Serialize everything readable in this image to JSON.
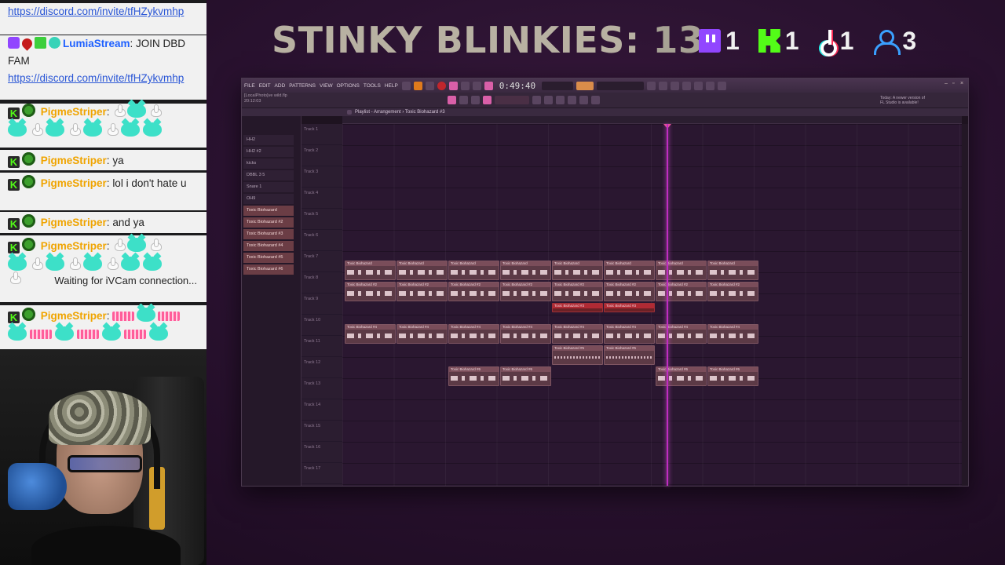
{
  "chat": {
    "messages": [
      {
        "type": "link",
        "text": "https://discord.com/invite/tfHZykvmhp"
      },
      {
        "type": "msg",
        "platform": "twitch",
        "name": "LumiaStream",
        "text": "JOIN DBD FAM"
      },
      {
        "type": "link",
        "text": "https://discord.com/invite/tfHZykvmhp"
      },
      {
        "type": "msg",
        "platform": "kick",
        "name": "PigmeStriper",
        "text": ""
      },
      {
        "type": "msg",
        "platform": "kick",
        "name": "PigmeStriper",
        "text": "ya"
      },
      {
        "type": "msg",
        "platform": "kick",
        "name": "PigmeStriper",
        "text": "lol i don't hate u"
      },
      {
        "type": "msg",
        "platform": "kick",
        "name": "PigmeStriper",
        "text": "and ya"
      },
      {
        "type": "msg",
        "platform": "kick",
        "name": "PigmeStriper",
        "text": ""
      },
      {
        "type": "msg",
        "platform": "kick",
        "name": "PigmeStriper",
        "text": ""
      }
    ],
    "status": "Waiting for iVCam connection..."
  },
  "title": {
    "text": "STINKY BLINKIES: ",
    "number": "13"
  },
  "counters": [
    {
      "icon": "twitch-icon",
      "value": "1"
    },
    {
      "icon": "kick-icon",
      "value": "1"
    },
    {
      "icon": "tiktok-icon",
      "value": "1"
    },
    {
      "icon": "viewer-icon",
      "value": "3"
    }
  ],
  "fl": {
    "menu": [
      "FILE",
      "EDIT",
      "ADD",
      "PATTERNS",
      "VIEW",
      "OPTIONS",
      "TOOLS",
      "HELP"
    ],
    "time": "0:49:40",
    "project_file": "[LocalPhoto]ve wild.flp",
    "project_time": "20:12:03",
    "notice": "Today: A newer version of FL Studio is available!",
    "breadcrumb": "Playlist - Arrangement › Toxic Biohazard #3",
    "browser_items": [
      "HH2",
      "HH2 #2",
      "kicks",
      "DBBL 3 5",
      "Snare 1",
      "OH9",
      "Toxic Biohazard",
      "Toxic Biohazard #2",
      "Toxic Biohazard #3",
      "Toxic Biohazard #4",
      "Toxic Biohazard #5",
      "Toxic Biohazard #6"
    ],
    "tracks": [
      "Track 1",
      "Track 2",
      "Track 3",
      "Track 4",
      "Track 5",
      "Track 6",
      "Track 7",
      "Track 8",
      "Track 9",
      "Track 10",
      "Track 11",
      "Track 12",
      "Track 13",
      "Track 14",
      "Track 15",
      "Track 16",
      "Track 17"
    ],
    "clip_label": "Toxic Biohazard",
    "clip_label_2": "Toxic Biohazard #2",
    "clip_label_3": "Toxic Biohazard #3",
    "clip_label_4": "Toxic Biohazard #4",
    "clip_label_5": "Toxic Biohazard #5",
    "clip_label_6": "Toxic Biohazard #6"
  }
}
